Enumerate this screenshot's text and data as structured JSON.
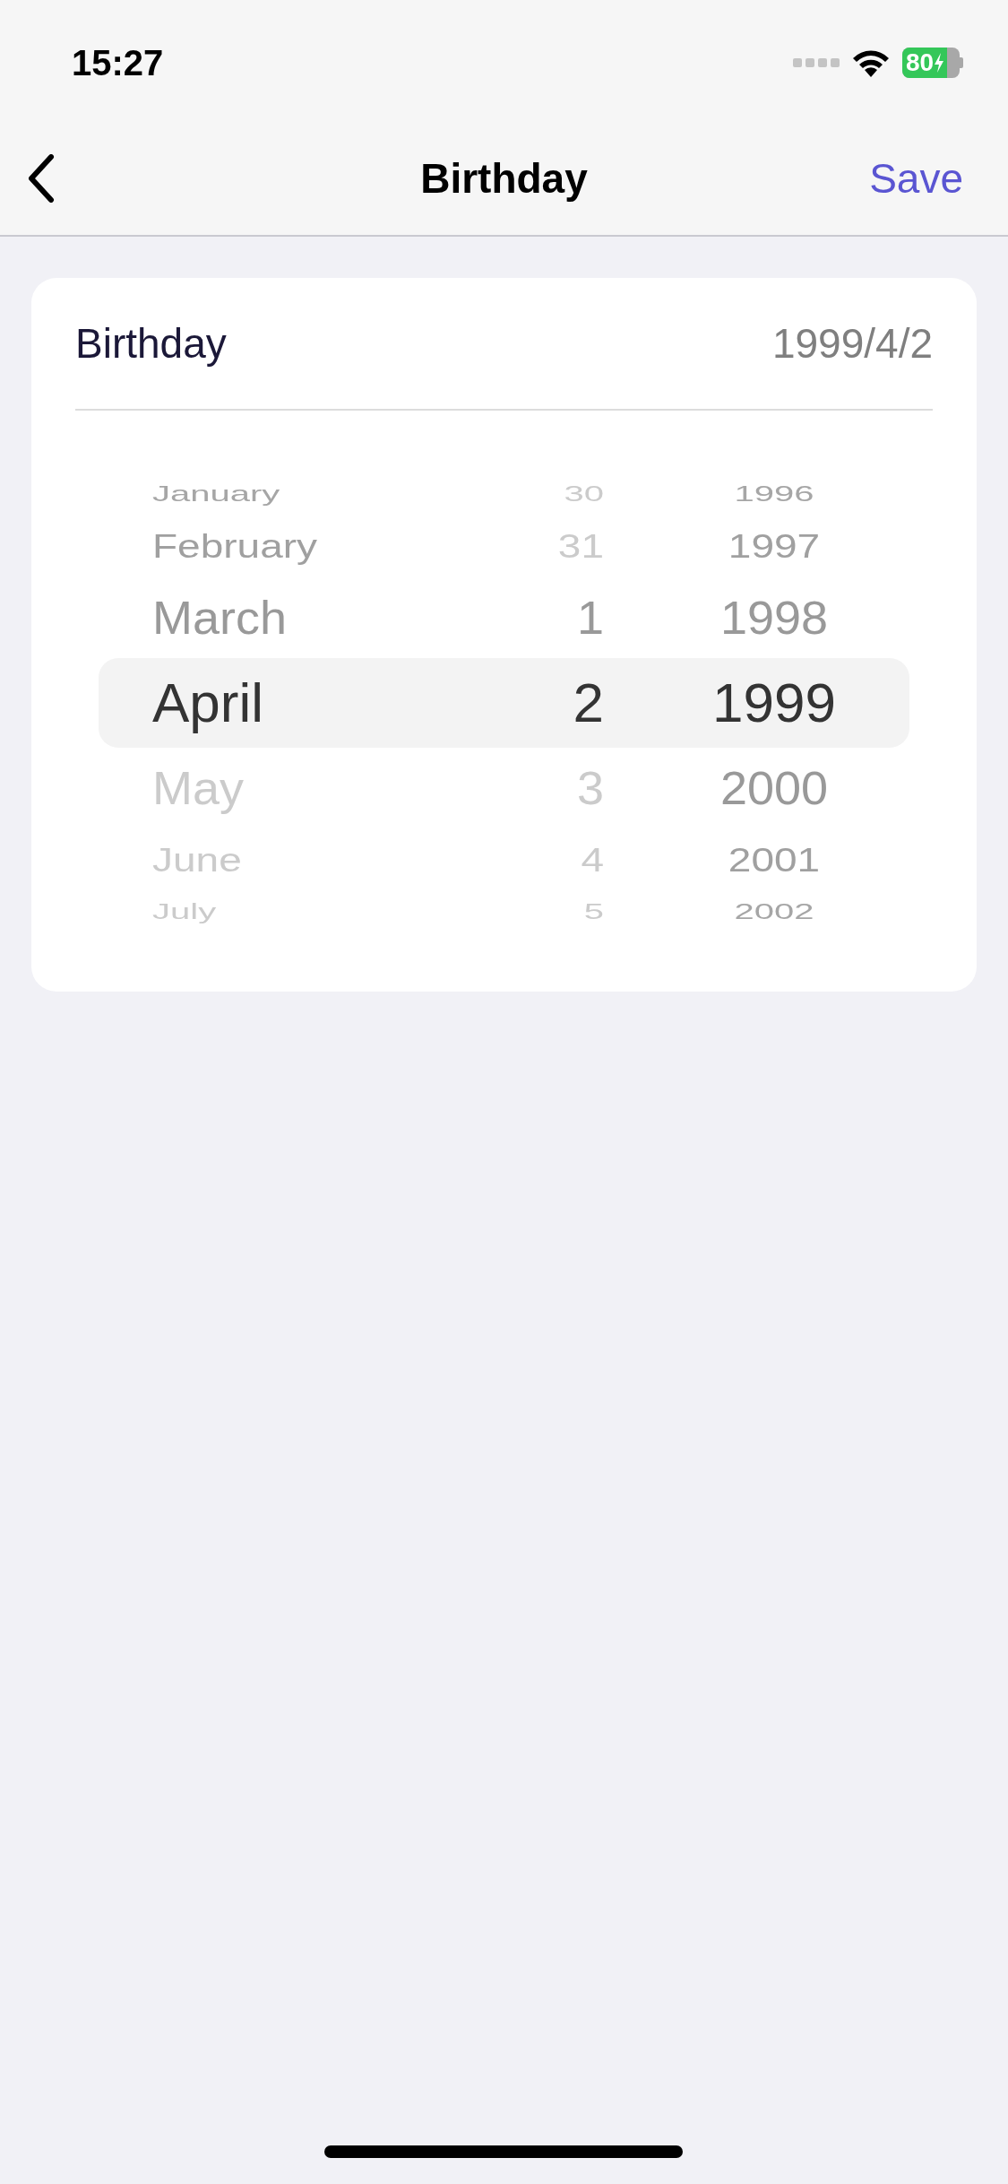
{
  "status_bar": {
    "time": "15:27",
    "battery": "80"
  },
  "nav": {
    "title": "Birthday",
    "action": "Save"
  },
  "field": {
    "label": "Birthday",
    "value": "1999/4/2"
  },
  "picker": {
    "columns": [
      {
        "kind": "month",
        "items": [
          {
            "label": "January",
            "selected": false,
            "disabled": false
          },
          {
            "label": "February",
            "selected": false,
            "disabled": false
          },
          {
            "label": "March",
            "selected": false,
            "disabled": false
          },
          {
            "label": "April",
            "selected": true,
            "disabled": false
          },
          {
            "label": "May",
            "selected": false,
            "disabled": true
          },
          {
            "label": "June",
            "selected": false,
            "disabled": true
          },
          {
            "label": "July",
            "selected": false,
            "disabled": true
          }
        ]
      },
      {
        "kind": "day",
        "items": [
          {
            "label": "30",
            "selected": false,
            "disabled": true
          },
          {
            "label": "31",
            "selected": false,
            "disabled": true
          },
          {
            "label": "1",
            "selected": false,
            "disabled": false
          },
          {
            "label": "2",
            "selected": true,
            "disabled": false
          },
          {
            "label": "3",
            "selected": false,
            "disabled": true
          },
          {
            "label": "4",
            "selected": false,
            "disabled": true
          },
          {
            "label": "5",
            "selected": false,
            "disabled": true
          }
        ]
      },
      {
        "kind": "year",
        "items": [
          {
            "label": "1996",
            "selected": false,
            "disabled": false
          },
          {
            "label": "1997",
            "selected": false,
            "disabled": false
          },
          {
            "label": "1998",
            "selected": false,
            "disabled": false
          },
          {
            "label": "1999",
            "selected": true,
            "disabled": false
          },
          {
            "label": "2000",
            "selected": false,
            "disabled": false
          },
          {
            "label": "2001",
            "selected": false,
            "disabled": false
          },
          {
            "label": "2002",
            "selected": false,
            "disabled": false
          }
        ]
      }
    ]
  }
}
